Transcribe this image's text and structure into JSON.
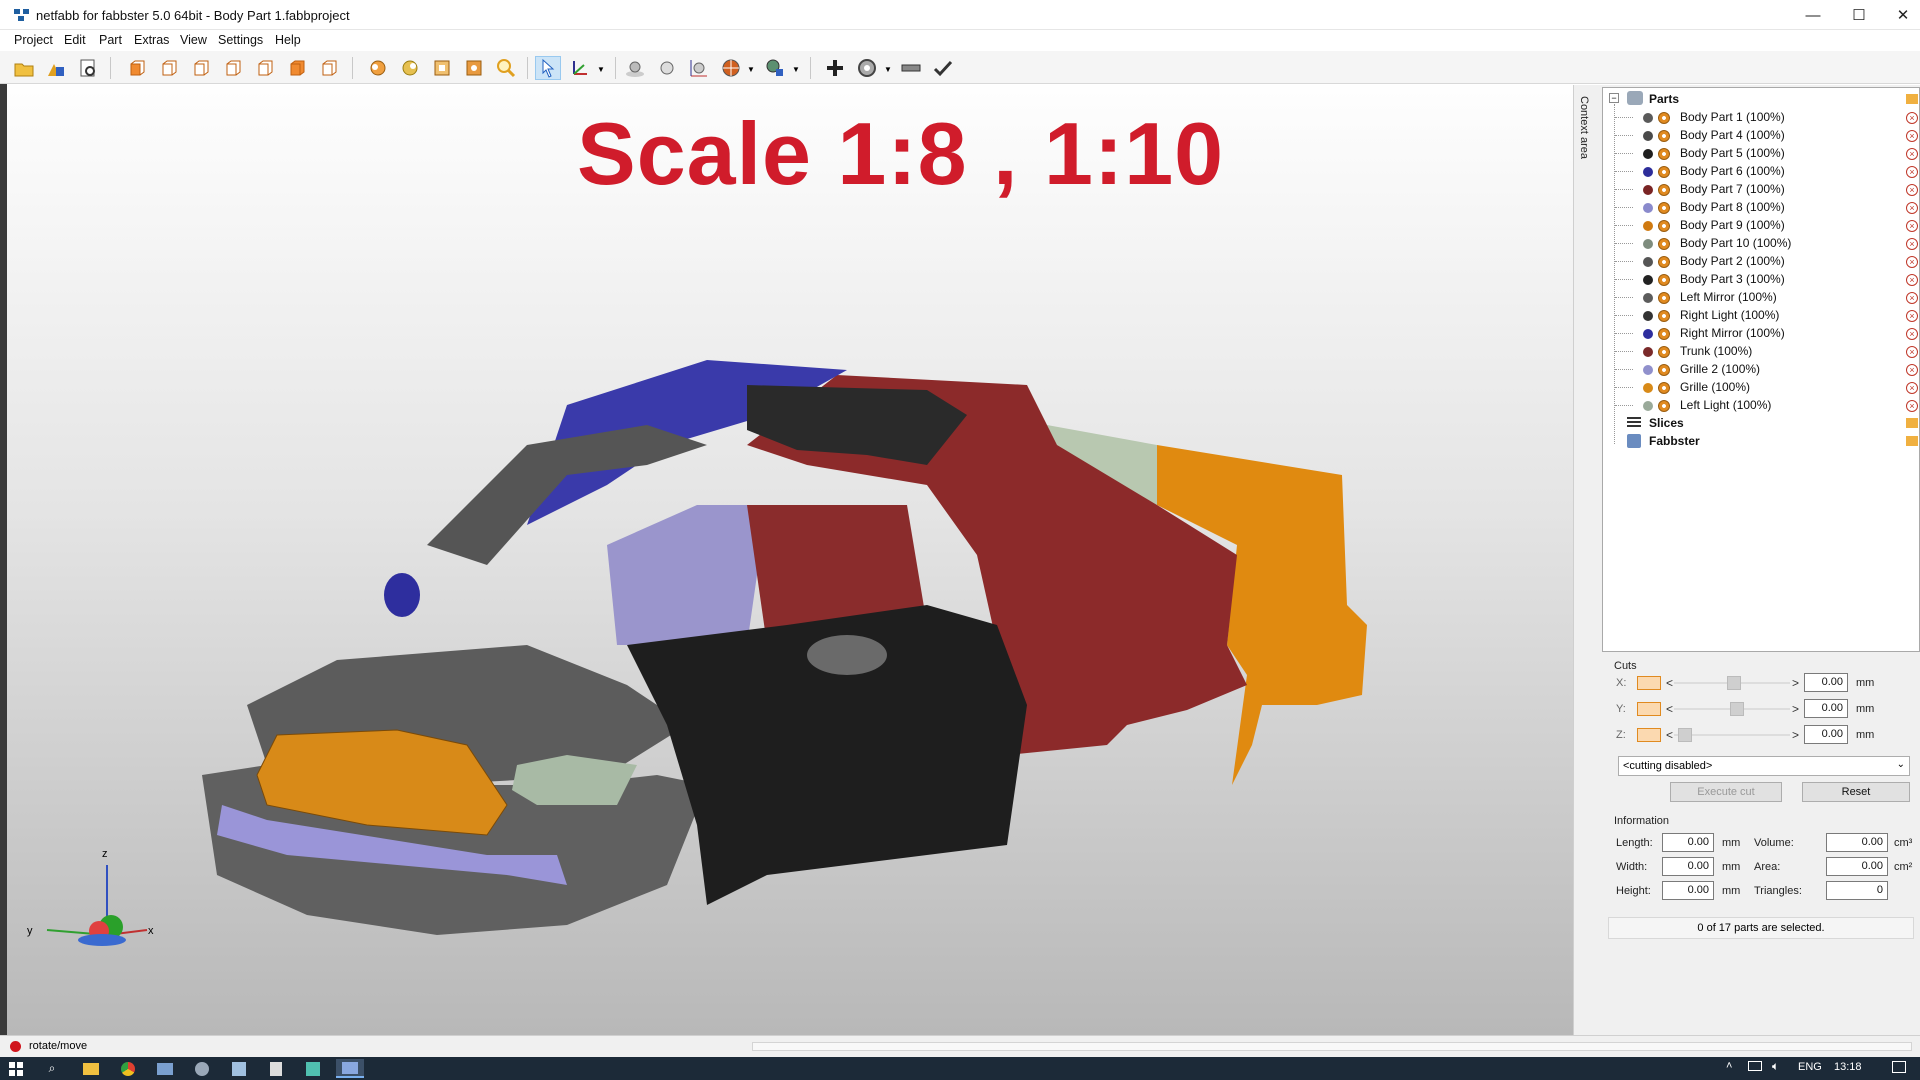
{
  "window": {
    "title": "netfabb for fabbster 5.0 64bit - Body Part 1.fabbproject"
  },
  "menu": [
    "Project",
    "Edit",
    "Part",
    "Extras",
    "View",
    "Settings",
    "Help"
  ],
  "viewport": {
    "banner": "Scale 1:8 , 1:10",
    "axes": {
      "x": "x",
      "y": "y",
      "z": "z"
    }
  },
  "context_area_label": "Context area",
  "tree": {
    "root": "Parts",
    "parts": [
      {
        "label": "Body Part 1 (100%)",
        "color": "#5a5a5a"
      },
      {
        "label": "Body Part 4 (100%)",
        "color": "#4a4a4a"
      },
      {
        "label": "Body Part 5 (100%)",
        "color": "#1f1f1f"
      },
      {
        "label": "Body Part 6 (100%)",
        "color": "#2d2d9a"
      },
      {
        "label": "Body Part 7 (100%)",
        "color": "#7a2424"
      },
      {
        "label": "Body Part 8 (100%)",
        "color": "#8a8acc"
      },
      {
        "label": "Body Part 9 (100%)",
        "color": "#d07a10"
      },
      {
        "label": "Body Part 10 (100%)",
        "color": "#7e8c7e"
      },
      {
        "label": "Body Part 2 (100%)",
        "color": "#555555"
      },
      {
        "label": "Body Part 3 (100%)",
        "color": "#222222"
      },
      {
        "label": "Left Mirror (100%)",
        "color": "#5c5c5c"
      },
      {
        "label": "Right Light (100%)",
        "color": "#333333"
      },
      {
        "label": "Right Mirror (100%)",
        "color": "#2e2e9e"
      },
      {
        "label": "Trunk (100%)",
        "color": "#7a2a2a"
      },
      {
        "label": "Grille 2 (100%)",
        "color": "#9090cc"
      },
      {
        "label": "Grille (100%)",
        "color": "#d88a18"
      },
      {
        "label": "Left Light (100%)",
        "color": "#9aaa9a"
      }
    ],
    "slices": "Slices",
    "fabbster": "Fabbster"
  },
  "cuts": {
    "title": "Cuts",
    "rows": [
      {
        "axis": "X:",
        "value": "0.00",
        "unit": "mm",
        "pos": 0.52
      },
      {
        "axis": "Y:",
        "value": "0.00",
        "unit": "mm",
        "pos": 0.55
      },
      {
        "axis": "Z:",
        "value": "0.00",
        "unit": "mm",
        "pos": 0.04
      }
    ],
    "mode": "<cutting disabled>",
    "execute": "Execute cut",
    "reset": "Reset"
  },
  "info": {
    "title": "Information",
    "length_label": "Length:",
    "length": "0.00",
    "width_label": "Width:",
    "width": "0.00",
    "height_label": "Height:",
    "height": "0.00",
    "mm": "mm",
    "volume_label": "Volume:",
    "volume": "0.00",
    "area_label": "Area:",
    "area": "0.00",
    "triangles_label": "Triangles:",
    "triangles": "0",
    "cm3": "cm³",
    "cm2": "cm²",
    "selection": "0 of 17 parts are selected."
  },
  "status": {
    "mode": "rotate/move"
  },
  "tray": {
    "lang": "ENG",
    "time": "13:18"
  },
  "colors": {
    "accent": "#d01c2b",
    "orange": "#e08a20"
  }
}
